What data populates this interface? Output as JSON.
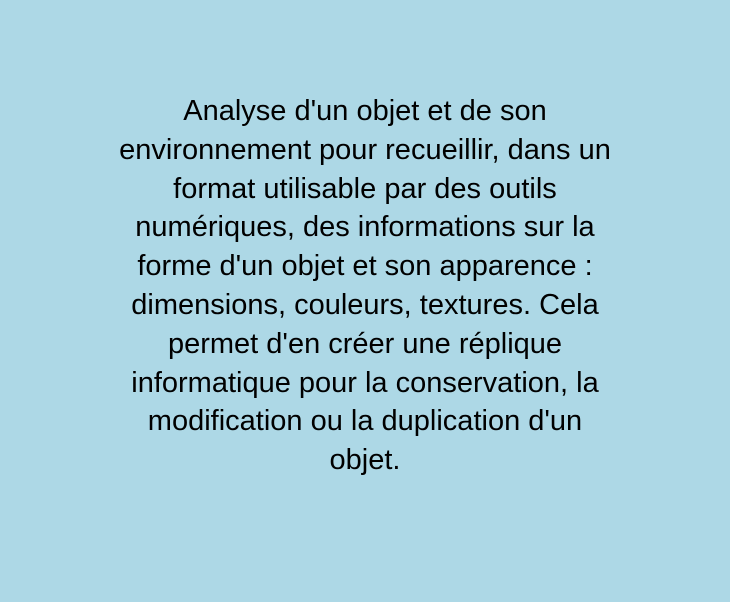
{
  "colors": {
    "background": "#add8e6",
    "text": "#000000"
  },
  "card": {
    "text": "Analyse d'un objet et de son\nenvironnement pour recueillir, dans un\nformat utilisable par des outils\nnumériques, des informations sur la\nforme d'un objet et son apparence :\ndimensions, couleurs, textures. Cela\npermet d'en créer une réplique\ninformatique pour la conservation, la\nmodification ou la duplication d'un\nobjet."
  }
}
